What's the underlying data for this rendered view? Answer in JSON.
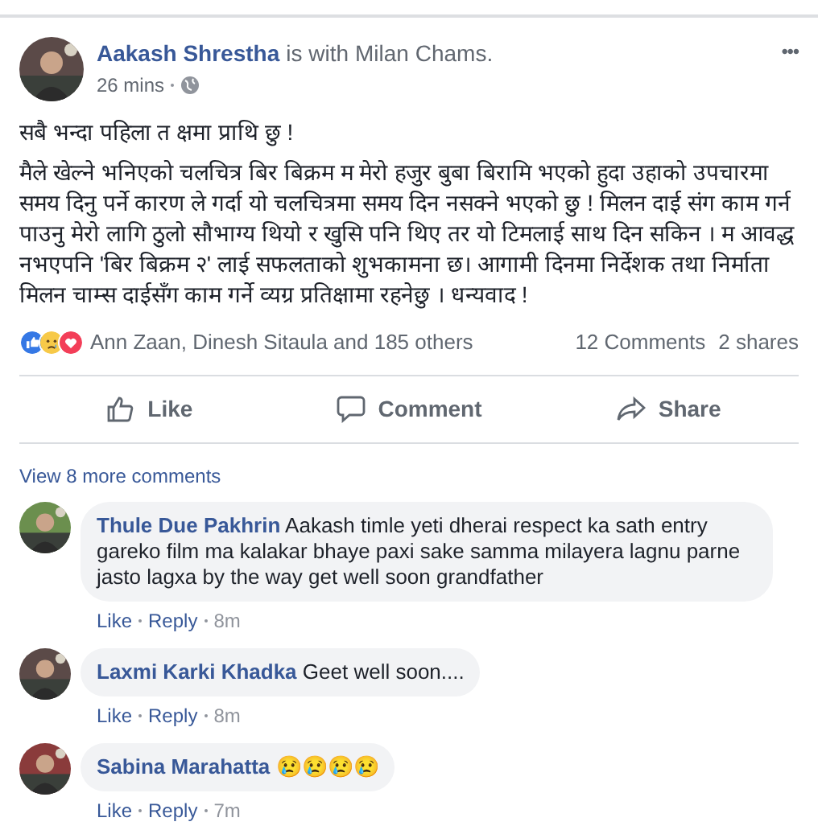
{
  "post": {
    "author": "Aakash Shrestha",
    "with_text": "is with",
    "tagged": "Milan Chams.",
    "time": "26 mins",
    "more": "•••",
    "paragraphs": [
      "सबै भन्दा पहिला त क्षमा प्राथि छु !",
      "मैले खेल्ने भनिएको चलचित्र बिर बिक्रम म मेरो हजुर बुबा बिरामि भएको हुदा उहाको उपचारमा समय दिनु पर्ने कारण ले गर्दा यो चलचित्रमा समय दिन नसक्ने भएको छु ! मिलन दाई संग काम गर्न पाउनु मेरो लागि ठुलो सौभाग्य थियो र खुसि पनि थिए तर यो टिमलाई साथ दिन सकिन । म आवद्ध नभएपनि 'बिर बिक्रम २' लाई सफलताको शुभकामना छ। आगामी दिनमा निर्देशक तथा निर्माता मिलन चाम्स दाईसँग काम गर्ने व्यग्र प्रतिक्षामा रहनेछु । धन्यवाद !"
    ]
  },
  "reactions": {
    "icons": [
      {
        "kind": "like"
      },
      {
        "kind": "sad"
      },
      {
        "kind": "love"
      }
    ],
    "names": "Ann Zaan, Dinesh Sitaula and 185 others",
    "comments": "12 Comments",
    "shares": "2 shares"
  },
  "actions": [
    {
      "kind": "like",
      "label": "Like"
    },
    {
      "kind": "comment",
      "label": "Comment"
    },
    {
      "kind": "share",
      "label": "Share"
    }
  ],
  "view_more": "View 8 more comments",
  "comments": [
    {
      "name": "Thule Due Pakhrin",
      "text": "Aakash timle yeti dherai respect ka sath entry gareko film ma kalakar bhaye paxi sake samma milayera lagnu parne jasto lagxa by the way get well soon grandfather",
      "like": "Like",
      "reply": "Reply",
      "time": "8m"
    },
    {
      "name": "Laxmi Karki Khadka",
      "text": "Geet well soon....",
      "like": "Like",
      "reply": "Reply",
      "time": "8m"
    },
    {
      "name": "Sabina Marahatta",
      "text": "😢😢😢😢",
      "like": "Like",
      "reply": "Reply",
      "time": "7m"
    }
  ]
}
